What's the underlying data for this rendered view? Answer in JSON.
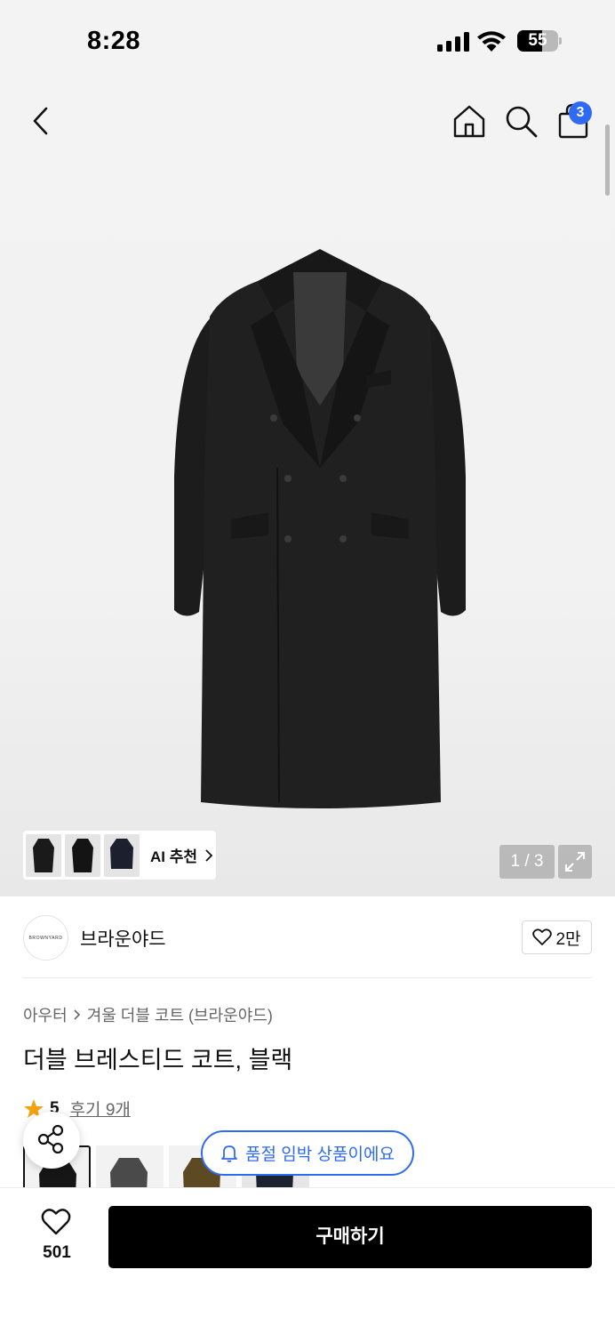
{
  "status_bar": {
    "time": "8:28",
    "battery": "55"
  },
  "header": {
    "cart_count": "3"
  },
  "gallery": {
    "ai_label": "AI 추천",
    "page_counter": "1 / 3"
  },
  "brand": {
    "logo_text": "BROWNYARD",
    "name": "브라운야드",
    "likes": "2만"
  },
  "product": {
    "breadcrumb_category": "아우터",
    "breadcrumb_collection": "겨울 더블 코트 (브라운야드)",
    "title": "더블 브레스티드 코트, 블랙",
    "rating": "5",
    "reviews": "후기 9개"
  },
  "toast": {
    "message": "품절 임박 상품이에요"
  },
  "bottom_bar": {
    "wish_count": "501",
    "buy_label": "구매하기"
  },
  "colors": {
    "accent": "#2f6bf2",
    "primary_button": "#000000"
  }
}
